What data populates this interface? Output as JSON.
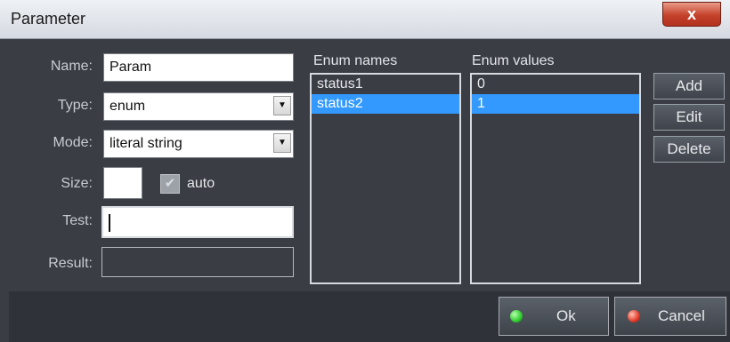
{
  "window": {
    "title": "Parameter",
    "close_label": "x"
  },
  "form": {
    "name_label": "Name:",
    "name_value": "Param",
    "type_label": "Type:",
    "type_value": "enum",
    "mode_label": "Mode:",
    "mode_value": "literal string",
    "size_label": "Size:",
    "size_value": "",
    "auto_label": "auto",
    "auto_checked": true,
    "test_label": "Test:",
    "test_value": "",
    "result_label": "Result:",
    "result_value": ""
  },
  "enum_names": {
    "label": "Enum names",
    "items": [
      "status1",
      "status2"
    ],
    "selected": 1
  },
  "enum_values": {
    "label": "Enum values",
    "items": [
      "0",
      "1"
    ],
    "selected": 1
  },
  "side_buttons": {
    "add": "Add",
    "edit": "Edit",
    "delete": "Delete"
  },
  "footer": {
    "ok": "Ok",
    "cancel": "Cancel"
  },
  "colors": {
    "selection": "#3399ff",
    "ok_led": "#2ecc2e",
    "cancel_led": "#e03a2a"
  }
}
